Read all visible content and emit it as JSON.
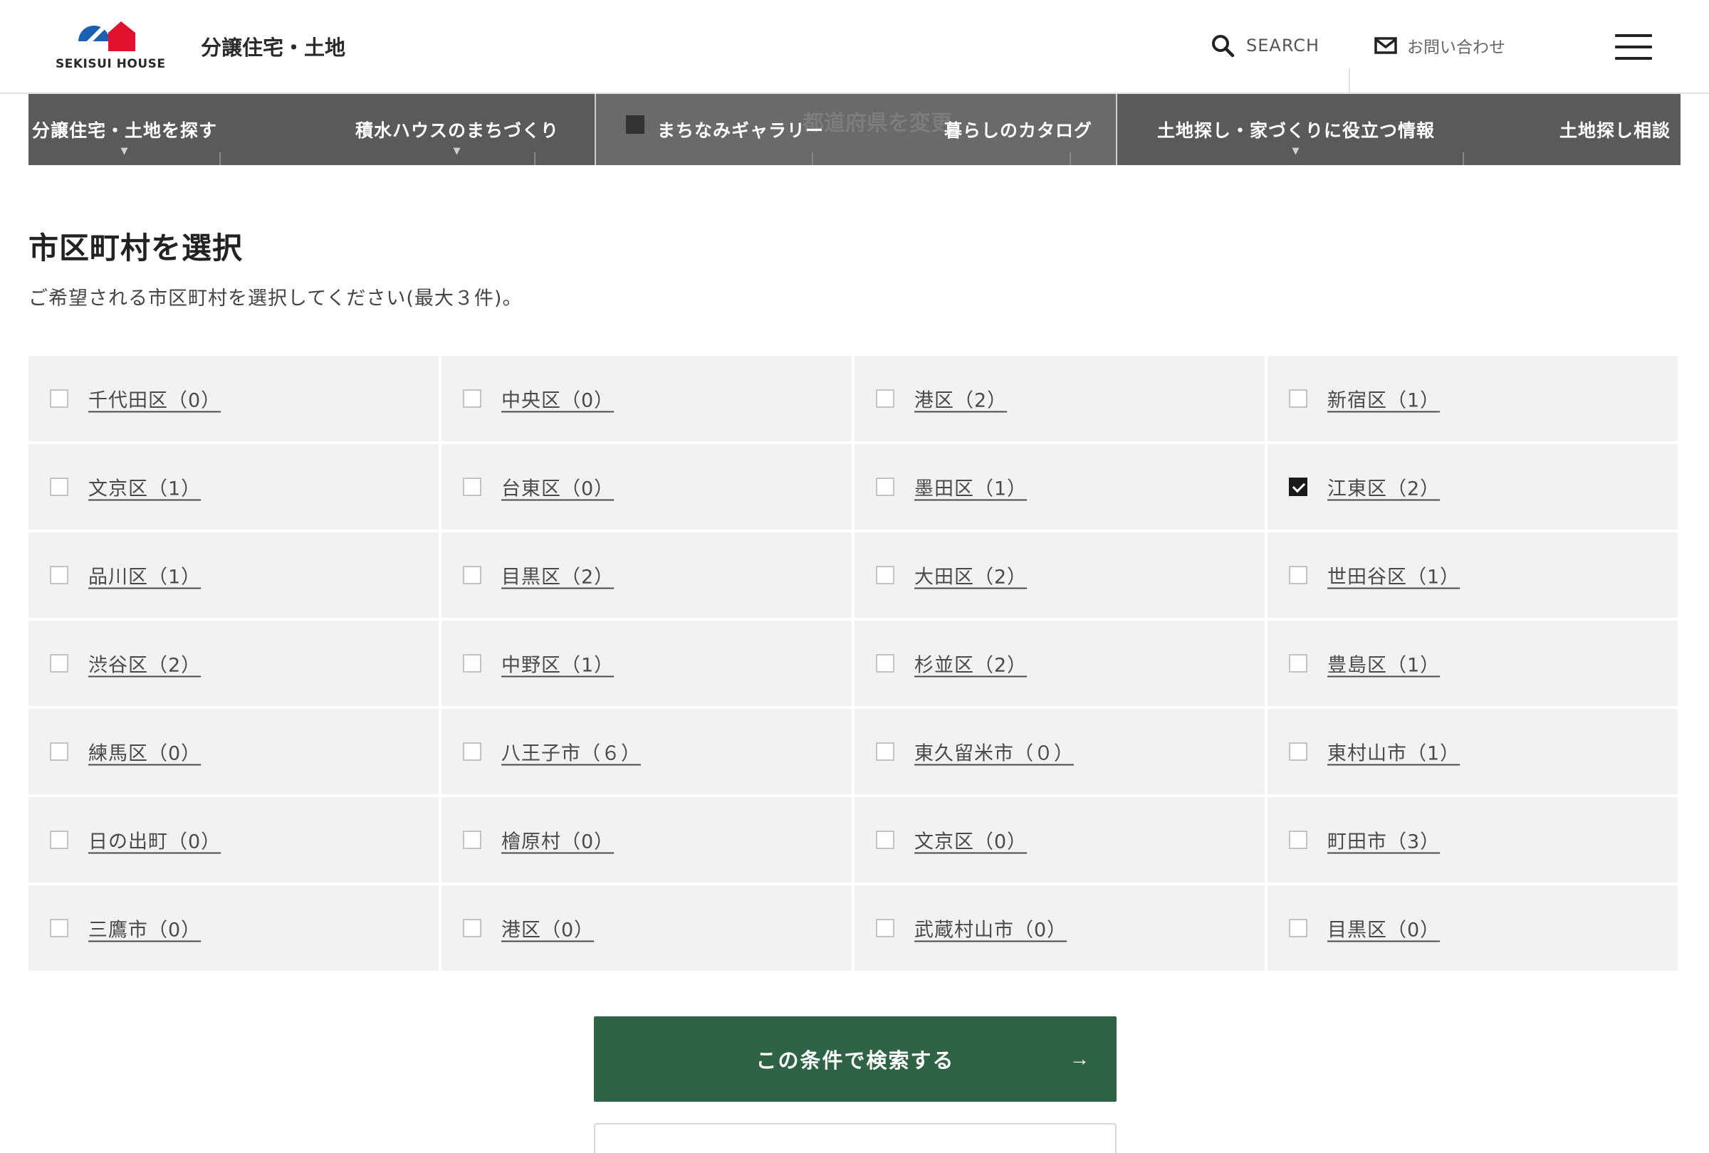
{
  "header": {
    "logo_text": "SEKISUI HOUSE",
    "site_title": "分譲住宅・土地",
    "search_label": "SEARCH",
    "contact_label": "お問い合わせ",
    "brand_colors": {
      "blue": "#1d5fb2",
      "red": "#e2122e"
    }
  },
  "nav": {
    "items": [
      {
        "label": "分譲住宅・土地を探す",
        "has_dropdown": true
      },
      {
        "label": "積水ハウスのまちづくり",
        "has_dropdown": true
      },
      {
        "label": "まちなみギャラリー",
        "has_dropdown": false
      },
      {
        "label": "暮らしのカタログ",
        "has_dropdown": false
      },
      {
        "label": "土地探し・家づくりに役立つ情報",
        "has_dropdown": true
      },
      {
        "label": "土地探し相談",
        "has_dropdown": false
      }
    ],
    "dropdown_caret": "▼",
    "overlapped_text": "都道府県を変更"
  },
  "section": {
    "title": "市区町村を選択",
    "description": "ご希望される市区町村を選択してください(最大３件)。"
  },
  "areas": [
    {
      "label": "千代田区（0）",
      "checked": false
    },
    {
      "label": "中央区（0）",
      "checked": false
    },
    {
      "label": "港区（2）",
      "checked": false
    },
    {
      "label": "新宿区（1）",
      "checked": false
    },
    {
      "label": "文京区（1）",
      "checked": false
    },
    {
      "label": "台東区（0）",
      "checked": false
    },
    {
      "label": "墨田区（1）",
      "checked": false
    },
    {
      "label": "江東区（2）",
      "checked": true
    },
    {
      "label": "品川区（1）",
      "checked": false
    },
    {
      "label": "目黒区（2）",
      "checked": false
    },
    {
      "label": "大田区（2）",
      "checked": false
    },
    {
      "label": "世田谷区（1）",
      "checked": false
    },
    {
      "label": "渋谷区（2）",
      "checked": false
    },
    {
      "label": "中野区（1）",
      "checked": false
    },
    {
      "label": "杉並区（2）",
      "checked": false
    },
    {
      "label": "豊島区（1）",
      "checked": false
    },
    {
      "label": "練馬区（0）",
      "checked": false
    },
    {
      "label": "八王子市（６）",
      "checked": false
    },
    {
      "label": "東久留米市（０）",
      "checked": false
    },
    {
      "label": "東村山市（1）",
      "checked": false
    },
    {
      "label": "日の出町（0）",
      "checked": false
    },
    {
      "label": "檜原村（0）",
      "checked": false
    },
    {
      "label": "文京区（0）",
      "checked": false
    },
    {
      "label": "町田市（3）",
      "checked": false
    },
    {
      "label": "三鷹市（0）",
      "checked": false
    },
    {
      "label": "港区（0）",
      "checked": false
    },
    {
      "label": "武蔵村山市（0）",
      "checked": false
    },
    {
      "label": "目黒区（0）",
      "checked": false
    }
  ],
  "submit": {
    "label": "この条件で検索する",
    "arrow": "→",
    "color": "#2e6345"
  }
}
